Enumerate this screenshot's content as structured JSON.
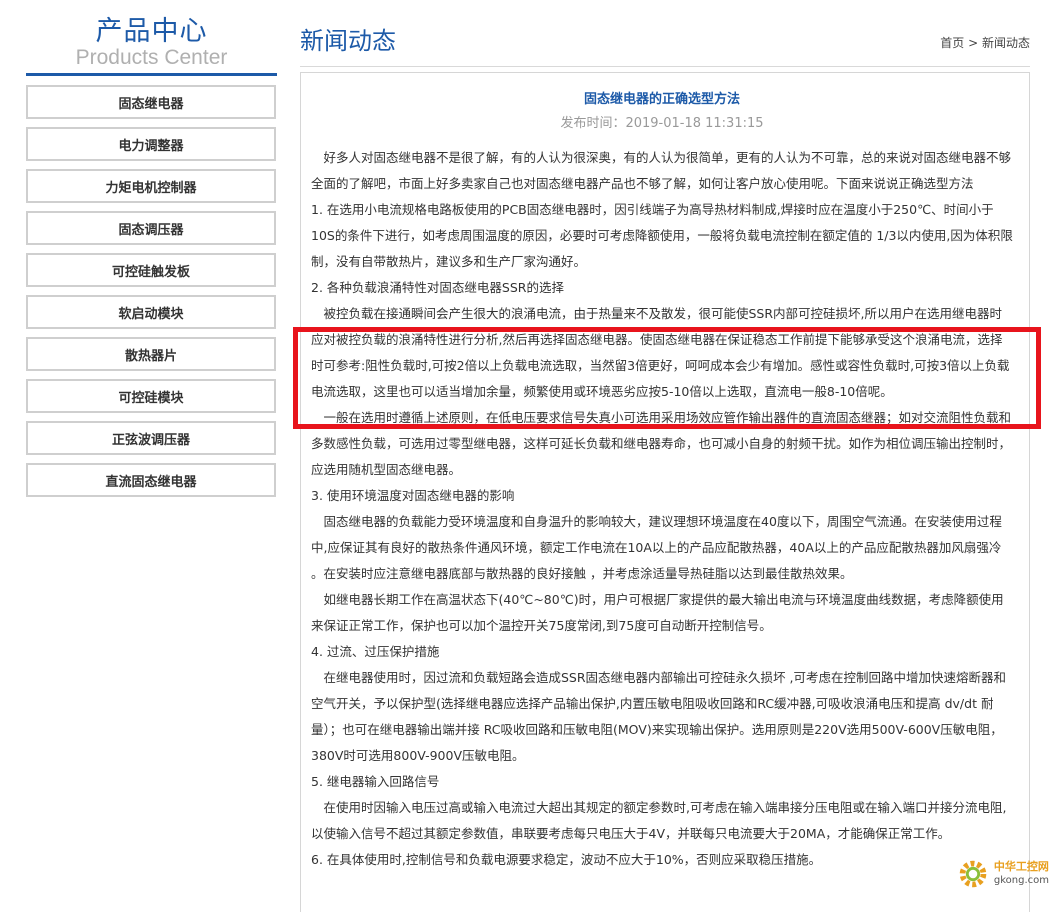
{
  "sidebar": {
    "title_cn": "产品中心",
    "title_en": "Products Center",
    "items": [
      {
        "label": "固态继电器"
      },
      {
        "label": "电力调整器"
      },
      {
        "label": "力矩电机控制器"
      },
      {
        "label": "固态调压器"
      },
      {
        "label": "可控硅触发板"
      },
      {
        "label": "软启动模块"
      },
      {
        "label": "散热器片"
      },
      {
        "label": "可控硅模块"
      },
      {
        "label": "正弦波调压器"
      },
      {
        "label": "直流固态继电器"
      }
    ]
  },
  "main": {
    "title": "新闻动态",
    "breadcrumb": {
      "home": "首页",
      "sep": ">",
      "current": "新闻动态"
    }
  },
  "article": {
    "title": "固态继电器的正确选型方法",
    "meta": "发布时间：2019-01-18 11:31:15",
    "paragraphs": [
      "　好多人对固态继电器不是很了解，有的人认为很深奥，有的人认为很简单，更有的人认为不可靠，总的来说对固态继电器不够全面的了解吧，市面上好多卖家自己也对固态继电器产品也不够了解，如何让客户放心使用呢。下面来说说正确选型方法",
      "1. 在选用小电流规格电路板使用的PCB固态继电器时，因引线端子为高导热材料制成,焊接时应在温度小于250℃、时间小于10S的条件下进行，如考虑周围温度的原因，必要时可考虑降额使用，一般将负载电流控制在额定值的 1/3以内使用,因为体积限制，没有自带散热片，建议多和生产厂家沟通好。",
      "2. 各种负载浪涌特性对固态继电器SSR的选择",
      "　被控负载在接通瞬间会产生很大的浪涌电流，由于热量来不及散发，很可能使SSR内部可控硅损坏,所以用户在选用继电器时应对被控负载的浪涌特性进行分析,然后再选择固态继电器。使固态继电器在保证稳态工作前提下能够承受这个浪涌电流，选择时可参考:阻性负载时,可按2倍以上负载电流选取，当然留3倍更好，呵呵成本会少有增加。感性或容性负载时,可按3倍以上负载电流选取，这里也可以适当增加余量，频繁使用或环境恶劣应按5-10倍以上选取，直流电一般8-10倍呢。",
      "　一般在选用时遵循上述原则，在低电压要求信号失真小可选用采用场效应管作输出器件的直流固态继器；如对交流阻性负载和多数感性负载，可选用过零型继电器，这样可延长负载和继电器寿命，也可减小自身的射频干扰。如作为相位调压输出控制时，应选用随机型固态继电器。",
      "3. 使用环境温度对固态继电器的影响",
      "　固态继电器的负载能力受环境温度和自身温升的影响较大，建议理想环境温度在40度以下，周围空气流通。在安装使用过程中,应保证其有良好的散热条件通风环境，额定工作电流在10A以上的产品应配散热器，40A以上的产品应配散热器加风扇强冷 。在安装时应注意继电器底部与散热器的良好接触 ，并考虑涂适量导热硅脂以达到最佳散热效果。",
      "　如继电器长期工作在高温状态下(40℃~80℃)时，用户可根据厂家提供的最大输出电流与环境温度曲线数据，考虑降额使用来保证正常工作，保护也可以加个温控开关75度常闭,到75度可自动断开控制信号。",
      "4. 过流、过压保护措施",
      "　在继电器使用时，因过流和负载短路会造成SSR固态继电器内部输出可控硅永久损坏 ,可考虑在控制回路中增加快速熔断器和空气开关，予以保护型(选择继电器应选择产品输出保护,内置压敏电阻吸收回路和RC缓冲器,可吸收浪涌电压和提高 dv/dt 耐量）；也可在继电器输出端并接 RC吸收回路和压敏电阻(MOV)来实现输出保护。选用原则是220V选用500V-600V压敏电阻，380V时可选用800V-900V压敏电阻。",
      "5. 继电器输入回路信号",
      "　在使用时因输入电压过高或输入电流过大超出其规定的额定参数时,可考虑在输入端串接分压电阻或在输入端口并接分流电阻,以使输入信号不超过其额定参数值，串联要考虑每只电压大于4V，并联每只电流要大于20MA，才能确保正常工作。",
      "6. 在具体使用时,控制信号和负载电源要求稳定，波动不应大于10%，否则应采取稳压措施。"
    ]
  },
  "watermark": {
    "site_cn": "中华工控网",
    "url": "gkong.com"
  },
  "colors": {
    "brand_blue": "#1d5aa8",
    "highlight_red": "#e8141c"
  }
}
